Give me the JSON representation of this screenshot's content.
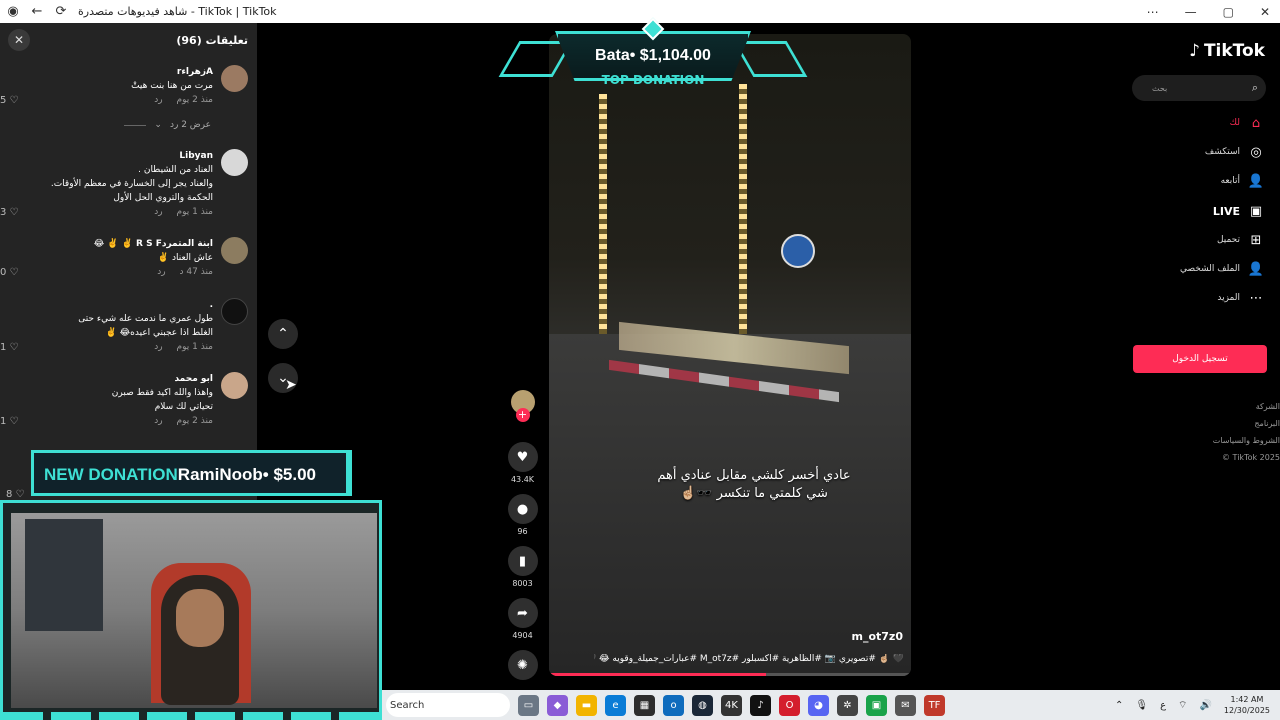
{
  "browser": {
    "tab_title": "شاهد فيديوهات متصدرة - TikTok | TikTok",
    "back_icon": "←",
    "refresh_icon": "⟳",
    "minimize_icon": "—",
    "maximize_icon": "▢",
    "close_icon": "✕",
    "menu_icon": "⋯"
  },
  "comments": {
    "title": "تعليقات (96)",
    "close_icon": "✕",
    "items": [
      {
        "name": "Aزهراءr",
        "text": "مرت من هنا بنت هيتْ",
        "time": "منذ 2 يوم",
        "reply": "رد",
        "likes": "5"
      },
      {
        "name": "Libyan",
        "text": "العناد من الشيطان .\nوالعناد يجر إلى الخسارة في معظم الأوقات.\nالحكمة والتروي الحل الأول",
        "time": "منذ 1 يوم",
        "reply": "رد",
        "likes": "3"
      },
      {
        "name": "ابنة المتمردR S F ✌️ ✌️ 😂",
        "text": "عاش العناد ✌️",
        "time": "منذ 47 د",
        "reply": "رد",
        "likes": "0"
      },
      {
        "name": ".",
        "text": "طول عمري ما ندمت عله شيء حتى\nالغلط اذا عجبني اعيده😂 ✌️",
        "time": "منذ 1 يوم",
        "reply": "رد",
        "likes": "1"
      },
      {
        "name": "ابو محمد",
        "text": "واهذا والله اكيد فقط صبرن\nتحياتي لك سلام",
        "time": "منذ 2 يوم",
        "reply": "رد",
        "likes": "1"
      }
    ],
    "view_replies": "عرض 2 رد",
    "extra_like_count": "8"
  },
  "video": {
    "caption": "عادي أخسر كلشي مقابل عنادي أهم\nشي كلمتي ما تنكسر 🕶️☝🏼",
    "author": "m_ot7z0",
    "hashtags": "🖤 ☝🏼 #تصويري 📷 #الظاهرية #اكسبلور #M_ot7z #عبارات_جميلة_وقويه 😂 🖤",
    "progress": 0.6
  },
  "actions": {
    "likes": "43.4K",
    "comments": "96",
    "saves": "8003",
    "shares": "4904",
    "follow_icon": "+"
  },
  "overlays": {
    "top_donation_amount": "Bata• $1,104.00",
    "top_donation_label": "TOP DONATION",
    "new_donation_prefix": "NEW DONATION",
    "new_donation_text": "RamiNoob• $5.00"
  },
  "sidebar": {
    "logo": "TikTok",
    "search_placeholder": "بحث",
    "items": [
      {
        "label": "لك",
        "icon": "⌂",
        "active": true
      },
      {
        "label": "استكشف",
        "icon": "◎"
      },
      {
        "label": "أتابعه",
        "icon": "👤"
      },
      {
        "label": "LIVE",
        "icon": "▣"
      },
      {
        "label": "تحميل",
        "icon": "⊞"
      },
      {
        "label": "الملف الشخصي",
        "icon": "👤"
      },
      {
        "label": "المزيد",
        "icon": "⋯"
      }
    ],
    "login": "تسجيل الدخول",
    "links": [
      "الشركة",
      "البرنامج",
      "الشروط والسياسات",
      "TikTok 2025 ©"
    ]
  },
  "taskbar": {
    "search": "Search",
    "time": "1:42 AM",
    "date": "12/30/2025",
    "lang": "ع"
  },
  "colors": {
    "accent": "#fe2c55",
    "overlay": "#3ee0d4",
    "panel": "#242424"
  }
}
